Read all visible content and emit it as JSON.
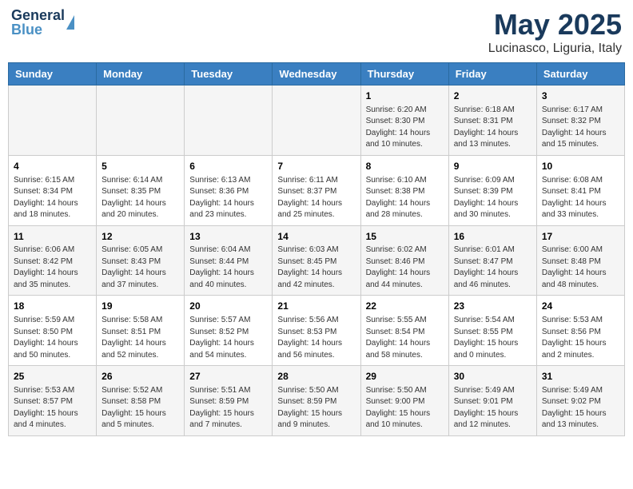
{
  "header": {
    "logo_general": "General",
    "logo_blue": "Blue",
    "month": "May 2025",
    "location": "Lucinasco, Liguria, Italy"
  },
  "weekdays": [
    "Sunday",
    "Monday",
    "Tuesday",
    "Wednesday",
    "Thursday",
    "Friday",
    "Saturday"
  ],
  "weeks": [
    [
      {
        "day": "",
        "info": ""
      },
      {
        "day": "",
        "info": ""
      },
      {
        "day": "",
        "info": ""
      },
      {
        "day": "",
        "info": ""
      },
      {
        "day": "1",
        "info": "Sunrise: 6:20 AM\nSunset: 8:30 PM\nDaylight: 14 hours\nand 10 minutes."
      },
      {
        "day": "2",
        "info": "Sunrise: 6:18 AM\nSunset: 8:31 PM\nDaylight: 14 hours\nand 13 minutes."
      },
      {
        "day": "3",
        "info": "Sunrise: 6:17 AM\nSunset: 8:32 PM\nDaylight: 14 hours\nand 15 minutes."
      }
    ],
    [
      {
        "day": "4",
        "info": "Sunrise: 6:15 AM\nSunset: 8:34 PM\nDaylight: 14 hours\nand 18 minutes."
      },
      {
        "day": "5",
        "info": "Sunrise: 6:14 AM\nSunset: 8:35 PM\nDaylight: 14 hours\nand 20 minutes."
      },
      {
        "day": "6",
        "info": "Sunrise: 6:13 AM\nSunset: 8:36 PM\nDaylight: 14 hours\nand 23 minutes."
      },
      {
        "day": "7",
        "info": "Sunrise: 6:11 AM\nSunset: 8:37 PM\nDaylight: 14 hours\nand 25 minutes."
      },
      {
        "day": "8",
        "info": "Sunrise: 6:10 AM\nSunset: 8:38 PM\nDaylight: 14 hours\nand 28 minutes."
      },
      {
        "day": "9",
        "info": "Sunrise: 6:09 AM\nSunset: 8:39 PM\nDaylight: 14 hours\nand 30 minutes."
      },
      {
        "day": "10",
        "info": "Sunrise: 6:08 AM\nSunset: 8:41 PM\nDaylight: 14 hours\nand 33 minutes."
      }
    ],
    [
      {
        "day": "11",
        "info": "Sunrise: 6:06 AM\nSunset: 8:42 PM\nDaylight: 14 hours\nand 35 minutes."
      },
      {
        "day": "12",
        "info": "Sunrise: 6:05 AM\nSunset: 8:43 PM\nDaylight: 14 hours\nand 37 minutes."
      },
      {
        "day": "13",
        "info": "Sunrise: 6:04 AM\nSunset: 8:44 PM\nDaylight: 14 hours\nand 40 minutes."
      },
      {
        "day": "14",
        "info": "Sunrise: 6:03 AM\nSunset: 8:45 PM\nDaylight: 14 hours\nand 42 minutes."
      },
      {
        "day": "15",
        "info": "Sunrise: 6:02 AM\nSunset: 8:46 PM\nDaylight: 14 hours\nand 44 minutes."
      },
      {
        "day": "16",
        "info": "Sunrise: 6:01 AM\nSunset: 8:47 PM\nDaylight: 14 hours\nand 46 minutes."
      },
      {
        "day": "17",
        "info": "Sunrise: 6:00 AM\nSunset: 8:48 PM\nDaylight: 14 hours\nand 48 minutes."
      }
    ],
    [
      {
        "day": "18",
        "info": "Sunrise: 5:59 AM\nSunset: 8:50 PM\nDaylight: 14 hours\nand 50 minutes."
      },
      {
        "day": "19",
        "info": "Sunrise: 5:58 AM\nSunset: 8:51 PM\nDaylight: 14 hours\nand 52 minutes."
      },
      {
        "day": "20",
        "info": "Sunrise: 5:57 AM\nSunset: 8:52 PM\nDaylight: 14 hours\nand 54 minutes."
      },
      {
        "day": "21",
        "info": "Sunrise: 5:56 AM\nSunset: 8:53 PM\nDaylight: 14 hours\nand 56 minutes."
      },
      {
        "day": "22",
        "info": "Sunrise: 5:55 AM\nSunset: 8:54 PM\nDaylight: 14 hours\nand 58 minutes."
      },
      {
        "day": "23",
        "info": "Sunrise: 5:54 AM\nSunset: 8:55 PM\nDaylight: 15 hours\nand 0 minutes."
      },
      {
        "day": "24",
        "info": "Sunrise: 5:53 AM\nSunset: 8:56 PM\nDaylight: 15 hours\nand 2 minutes."
      }
    ],
    [
      {
        "day": "25",
        "info": "Sunrise: 5:53 AM\nSunset: 8:57 PM\nDaylight: 15 hours\nand 4 minutes."
      },
      {
        "day": "26",
        "info": "Sunrise: 5:52 AM\nSunset: 8:58 PM\nDaylight: 15 hours\nand 5 minutes."
      },
      {
        "day": "27",
        "info": "Sunrise: 5:51 AM\nSunset: 8:59 PM\nDaylight: 15 hours\nand 7 minutes."
      },
      {
        "day": "28",
        "info": "Sunrise: 5:50 AM\nSunset: 8:59 PM\nDaylight: 15 hours\nand 9 minutes."
      },
      {
        "day": "29",
        "info": "Sunrise: 5:50 AM\nSunset: 9:00 PM\nDaylight: 15 hours\nand 10 minutes."
      },
      {
        "day": "30",
        "info": "Sunrise: 5:49 AM\nSunset: 9:01 PM\nDaylight: 15 hours\nand 12 minutes."
      },
      {
        "day": "31",
        "info": "Sunrise: 5:49 AM\nSunset: 9:02 PM\nDaylight: 15 hours\nand 13 minutes."
      }
    ]
  ]
}
